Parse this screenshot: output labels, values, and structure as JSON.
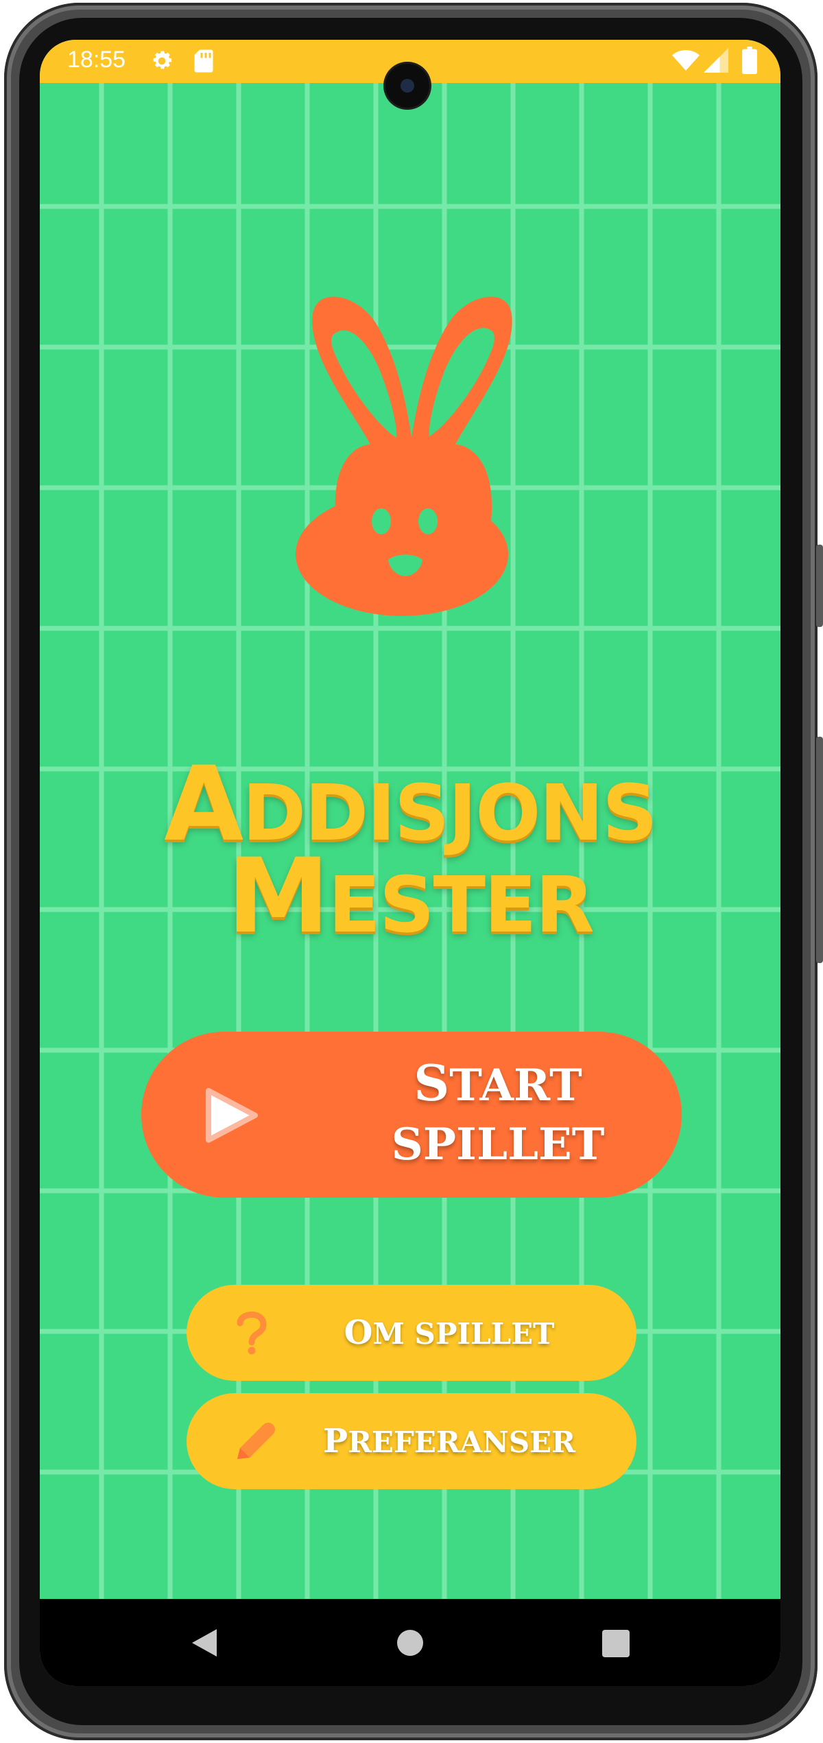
{
  "status_bar": {
    "time": "18:55",
    "icons": [
      "settings-icon",
      "sd-card-icon",
      "wifi-icon",
      "signal-icon",
      "battery-icon"
    ]
  },
  "app": {
    "title_line1_first": "A",
    "title_line1_rest": "DDISJONS",
    "title_line2_first": "M",
    "title_line2_rest": "ESTER",
    "logo": "bunny-icon"
  },
  "buttons": {
    "start": {
      "line1_first": "S",
      "line1_rest": "TART",
      "line2": "SPILLET",
      "icon": "play-icon"
    },
    "about": {
      "first": "O",
      "rest": "M SPILLET",
      "icon": "question-icon"
    },
    "preferences": {
      "first": "P",
      "rest": "REFERANSER",
      "icon": "pencil-icon"
    }
  },
  "nav_bar": {
    "buttons": [
      "back-icon",
      "home-icon",
      "recents-icon"
    ]
  },
  "colors": {
    "background": "#41da84",
    "grid_lines": "#7ceaab",
    "accent_orange": "#fe7035",
    "accent_yellow": "#fdc526"
  }
}
